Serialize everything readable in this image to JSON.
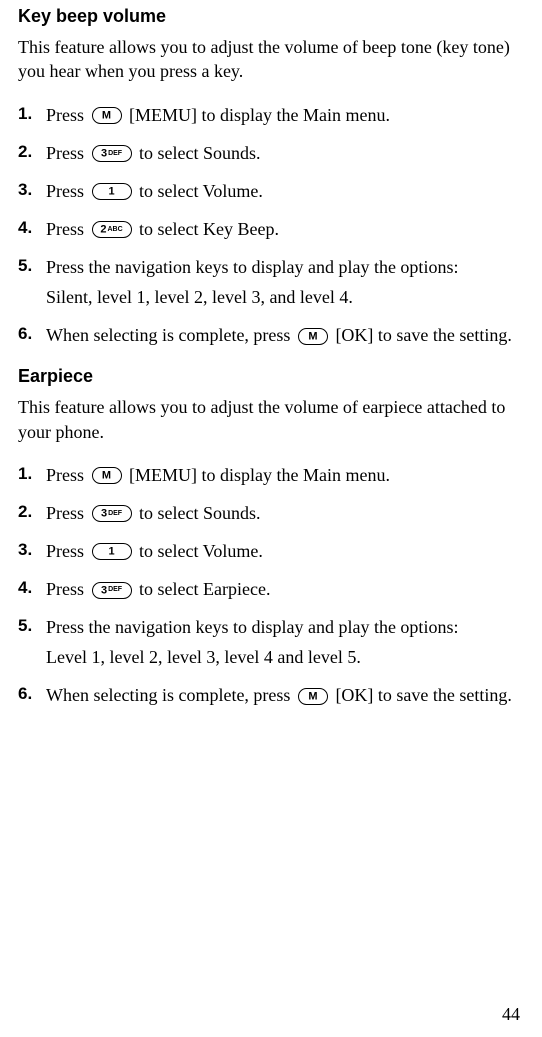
{
  "sections": [
    {
      "title": "Key beep volume",
      "desc": "This feature allows you to adjust the volume of beep tone (key tone) you hear when you press a key.",
      "steps": [
        {
          "num": "1.",
          "pre": "Press ",
          "key_type": "M",
          "post": " [MEMU] to display the Main menu."
        },
        {
          "num": "2.",
          "pre": "Press ",
          "key_type": "3DEF",
          "post": " to select Sounds."
        },
        {
          "num": "3.",
          "pre": "Press ",
          "key_type": "1",
          "post": " to select Volume."
        },
        {
          "num": "4.",
          "pre": "Press ",
          "key_type": "2ABC",
          "post": " to select Key Beep."
        },
        {
          "num": "5.",
          "text": "Press the navigation keys to display and play the options:",
          "sub": "Silent, level 1, level 2, level 3, and level 4."
        },
        {
          "num": "6.",
          "pre": "When selecting is complete, press ",
          "key_type": "M",
          "post": " [OK] to save the setting."
        }
      ]
    },
    {
      "title": "Earpiece",
      "desc": "This feature allows you to adjust the volume of earpiece attached to your phone.",
      "steps": [
        {
          "num": "1.",
          "pre": "Press ",
          "key_type": "M",
          "post": " [MEMU] to display the Main menu."
        },
        {
          "num": "2.",
          "pre": "Press ",
          "key_type": "3DEF",
          "post": " to select Sounds."
        },
        {
          "num": "3.",
          "pre": "Press ",
          "key_type": "1",
          "post": " to select Volume."
        },
        {
          "num": "4.",
          "pre": "Press ",
          "key_type": "3DEF",
          "post": " to select Earpiece."
        },
        {
          "num": "5.",
          "text": "Press the navigation keys to display and play the options:",
          "sub": "Level 1, level 2, level 3, level 4 and level 5."
        },
        {
          "num": "6.",
          "pre": "When selecting is complete, press ",
          "key_type": "M",
          "post": " [OK] to save the setting."
        }
      ]
    }
  ],
  "page_number": "44",
  "keys": {
    "M": {
      "big": "M",
      "sup": ""
    },
    "1": {
      "big": "1",
      "sup": ""
    },
    "2ABC": {
      "big": "2",
      "sup": "ABC"
    },
    "3DEF": {
      "big": "3",
      "sup": "DEF"
    }
  }
}
